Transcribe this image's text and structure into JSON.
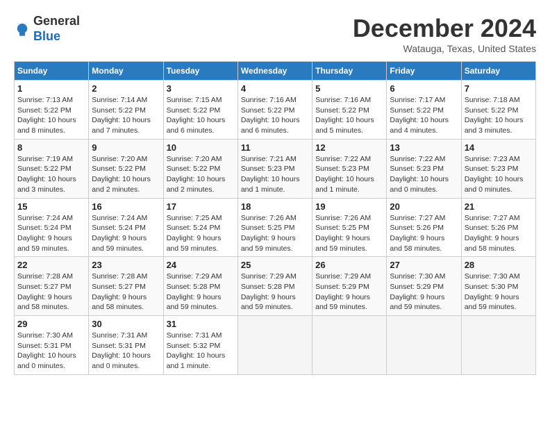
{
  "header": {
    "logo_general": "General",
    "logo_blue": "Blue",
    "month_title": "December 2024",
    "location": "Watauga, Texas, United States"
  },
  "weekdays": [
    "Sunday",
    "Monday",
    "Tuesday",
    "Wednesday",
    "Thursday",
    "Friday",
    "Saturday"
  ],
  "weeks": [
    [
      {
        "day": "1",
        "info": "Sunrise: 7:13 AM\nSunset: 5:22 PM\nDaylight: 10 hours and 8 minutes."
      },
      {
        "day": "2",
        "info": "Sunrise: 7:14 AM\nSunset: 5:22 PM\nDaylight: 10 hours and 7 minutes."
      },
      {
        "day": "3",
        "info": "Sunrise: 7:15 AM\nSunset: 5:22 PM\nDaylight: 10 hours and 6 minutes."
      },
      {
        "day": "4",
        "info": "Sunrise: 7:16 AM\nSunset: 5:22 PM\nDaylight: 10 hours and 6 minutes."
      },
      {
        "day": "5",
        "info": "Sunrise: 7:16 AM\nSunset: 5:22 PM\nDaylight: 10 hours and 5 minutes."
      },
      {
        "day": "6",
        "info": "Sunrise: 7:17 AM\nSunset: 5:22 PM\nDaylight: 10 hours and 4 minutes."
      },
      {
        "day": "7",
        "info": "Sunrise: 7:18 AM\nSunset: 5:22 PM\nDaylight: 10 hours and 3 minutes."
      }
    ],
    [
      {
        "day": "8",
        "info": "Sunrise: 7:19 AM\nSunset: 5:22 PM\nDaylight: 10 hours and 3 minutes."
      },
      {
        "day": "9",
        "info": "Sunrise: 7:20 AM\nSunset: 5:22 PM\nDaylight: 10 hours and 2 minutes."
      },
      {
        "day": "10",
        "info": "Sunrise: 7:20 AM\nSunset: 5:22 PM\nDaylight: 10 hours and 2 minutes."
      },
      {
        "day": "11",
        "info": "Sunrise: 7:21 AM\nSunset: 5:23 PM\nDaylight: 10 hours and 1 minute."
      },
      {
        "day": "12",
        "info": "Sunrise: 7:22 AM\nSunset: 5:23 PM\nDaylight: 10 hours and 1 minute."
      },
      {
        "day": "13",
        "info": "Sunrise: 7:22 AM\nSunset: 5:23 PM\nDaylight: 10 hours and 0 minutes."
      },
      {
        "day": "14",
        "info": "Sunrise: 7:23 AM\nSunset: 5:23 PM\nDaylight: 10 hours and 0 minutes."
      }
    ],
    [
      {
        "day": "15",
        "info": "Sunrise: 7:24 AM\nSunset: 5:24 PM\nDaylight: 9 hours and 59 minutes."
      },
      {
        "day": "16",
        "info": "Sunrise: 7:24 AM\nSunset: 5:24 PM\nDaylight: 9 hours and 59 minutes."
      },
      {
        "day": "17",
        "info": "Sunrise: 7:25 AM\nSunset: 5:24 PM\nDaylight: 9 hours and 59 minutes."
      },
      {
        "day": "18",
        "info": "Sunrise: 7:26 AM\nSunset: 5:25 PM\nDaylight: 9 hours and 59 minutes."
      },
      {
        "day": "19",
        "info": "Sunrise: 7:26 AM\nSunset: 5:25 PM\nDaylight: 9 hours and 59 minutes."
      },
      {
        "day": "20",
        "info": "Sunrise: 7:27 AM\nSunset: 5:26 PM\nDaylight: 9 hours and 58 minutes."
      },
      {
        "day": "21",
        "info": "Sunrise: 7:27 AM\nSunset: 5:26 PM\nDaylight: 9 hours and 58 minutes."
      }
    ],
    [
      {
        "day": "22",
        "info": "Sunrise: 7:28 AM\nSunset: 5:27 PM\nDaylight: 9 hours and 58 minutes."
      },
      {
        "day": "23",
        "info": "Sunrise: 7:28 AM\nSunset: 5:27 PM\nDaylight: 9 hours and 58 minutes."
      },
      {
        "day": "24",
        "info": "Sunrise: 7:29 AM\nSunset: 5:28 PM\nDaylight: 9 hours and 59 minutes."
      },
      {
        "day": "25",
        "info": "Sunrise: 7:29 AM\nSunset: 5:28 PM\nDaylight: 9 hours and 59 minutes."
      },
      {
        "day": "26",
        "info": "Sunrise: 7:29 AM\nSunset: 5:29 PM\nDaylight: 9 hours and 59 minutes."
      },
      {
        "day": "27",
        "info": "Sunrise: 7:30 AM\nSunset: 5:29 PM\nDaylight: 9 hours and 59 minutes."
      },
      {
        "day": "28",
        "info": "Sunrise: 7:30 AM\nSunset: 5:30 PM\nDaylight: 9 hours and 59 minutes."
      }
    ],
    [
      {
        "day": "29",
        "info": "Sunrise: 7:30 AM\nSunset: 5:31 PM\nDaylight: 10 hours and 0 minutes."
      },
      {
        "day": "30",
        "info": "Sunrise: 7:31 AM\nSunset: 5:31 PM\nDaylight: 10 hours and 0 minutes."
      },
      {
        "day": "31",
        "info": "Sunrise: 7:31 AM\nSunset: 5:32 PM\nDaylight: 10 hours and 1 minute."
      },
      null,
      null,
      null,
      null
    ]
  ]
}
